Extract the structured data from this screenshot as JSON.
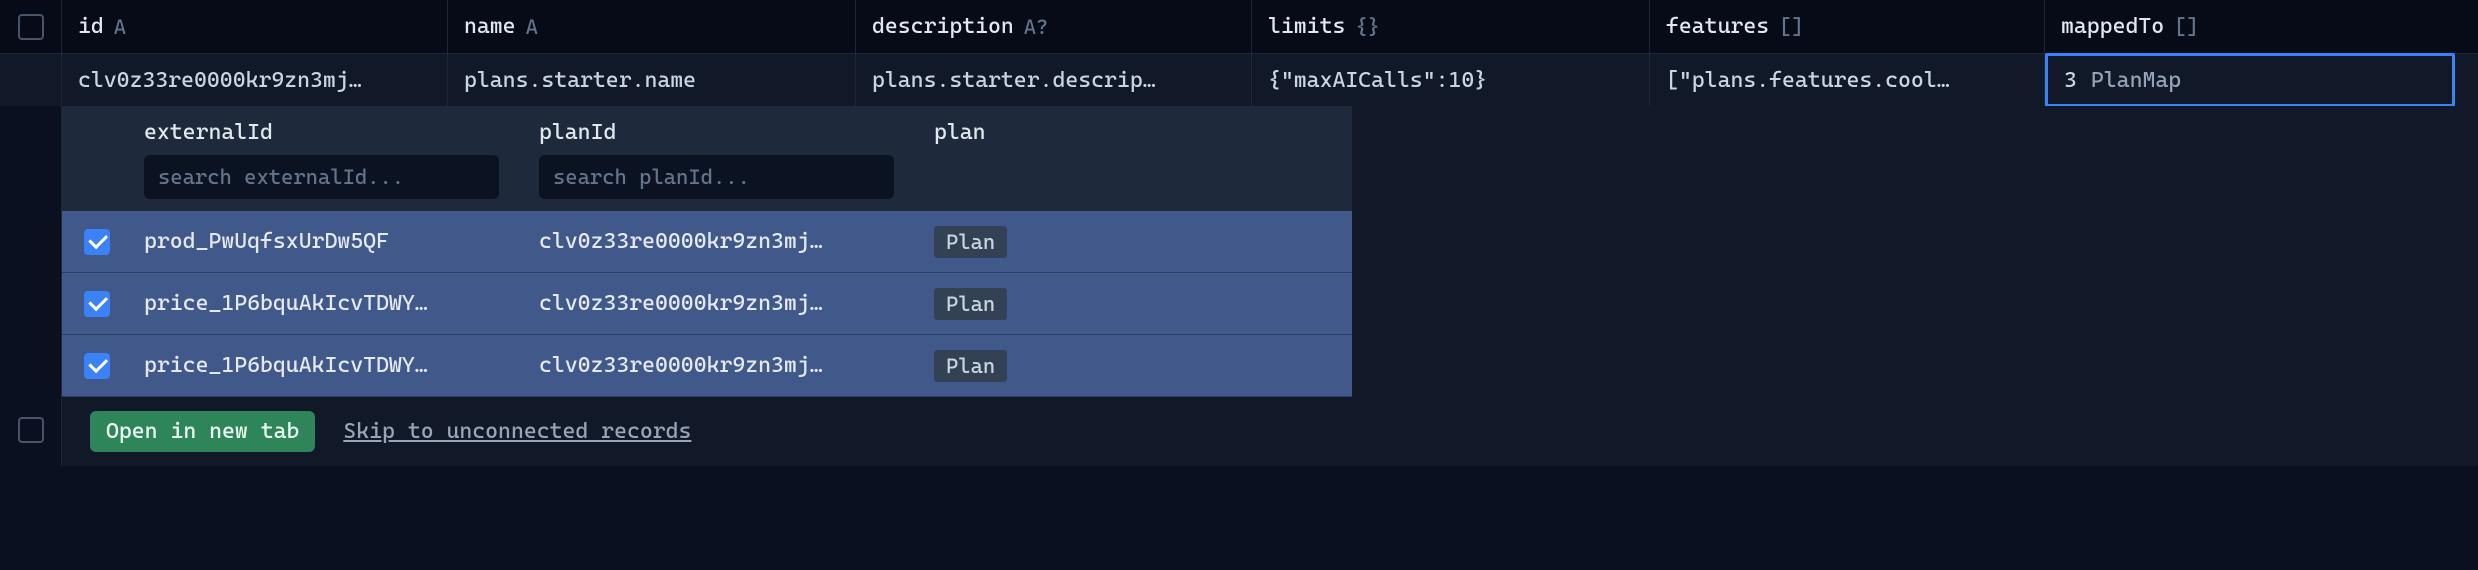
{
  "columns": {
    "id": {
      "label": "id",
      "type": "A"
    },
    "name": {
      "label": "name",
      "type": "A"
    },
    "description": {
      "label": "description",
      "type": "A?"
    },
    "limits": {
      "label": "limits",
      "type": "{}"
    },
    "features": {
      "label": "features",
      "type": "[]"
    },
    "mappedTo": {
      "label": "mappedTo",
      "type": "[]"
    }
  },
  "row": {
    "id": "clv0z33re0000kr9zn3mj…",
    "name": "plans.starter.name",
    "description": "plans.starter.descrip…",
    "limits": "{\"maxAICalls\":10}",
    "features": "[\"plans.features.cool…",
    "mappedTo": {
      "count": "3",
      "type": "PlanMap"
    }
  },
  "nested": {
    "columns": {
      "externalId": "externalId",
      "planId": "planId",
      "plan": "plan"
    },
    "search": {
      "externalIdPlaceholder": "search externalId...",
      "planIdPlaceholder": "search planId..."
    },
    "rows": [
      {
        "externalId": "prod_PwUqfsxUrDw5QF",
        "planId": "clv0z33re0000kr9zn3mj…",
        "planBadge": "Plan"
      },
      {
        "externalId": "price_1P6bquAkIcvTDWY…",
        "planId": "clv0z33re0000kr9zn3mj…",
        "planBadge": "Plan"
      },
      {
        "externalId": "price_1P6bquAkIcvTDWY…",
        "planId": "clv0z33re0000kr9zn3mj…",
        "planBadge": "Plan"
      }
    ]
  },
  "footer": {
    "openLabel": "Open in new tab",
    "skipLabel": "Skip to unconnected records"
  }
}
